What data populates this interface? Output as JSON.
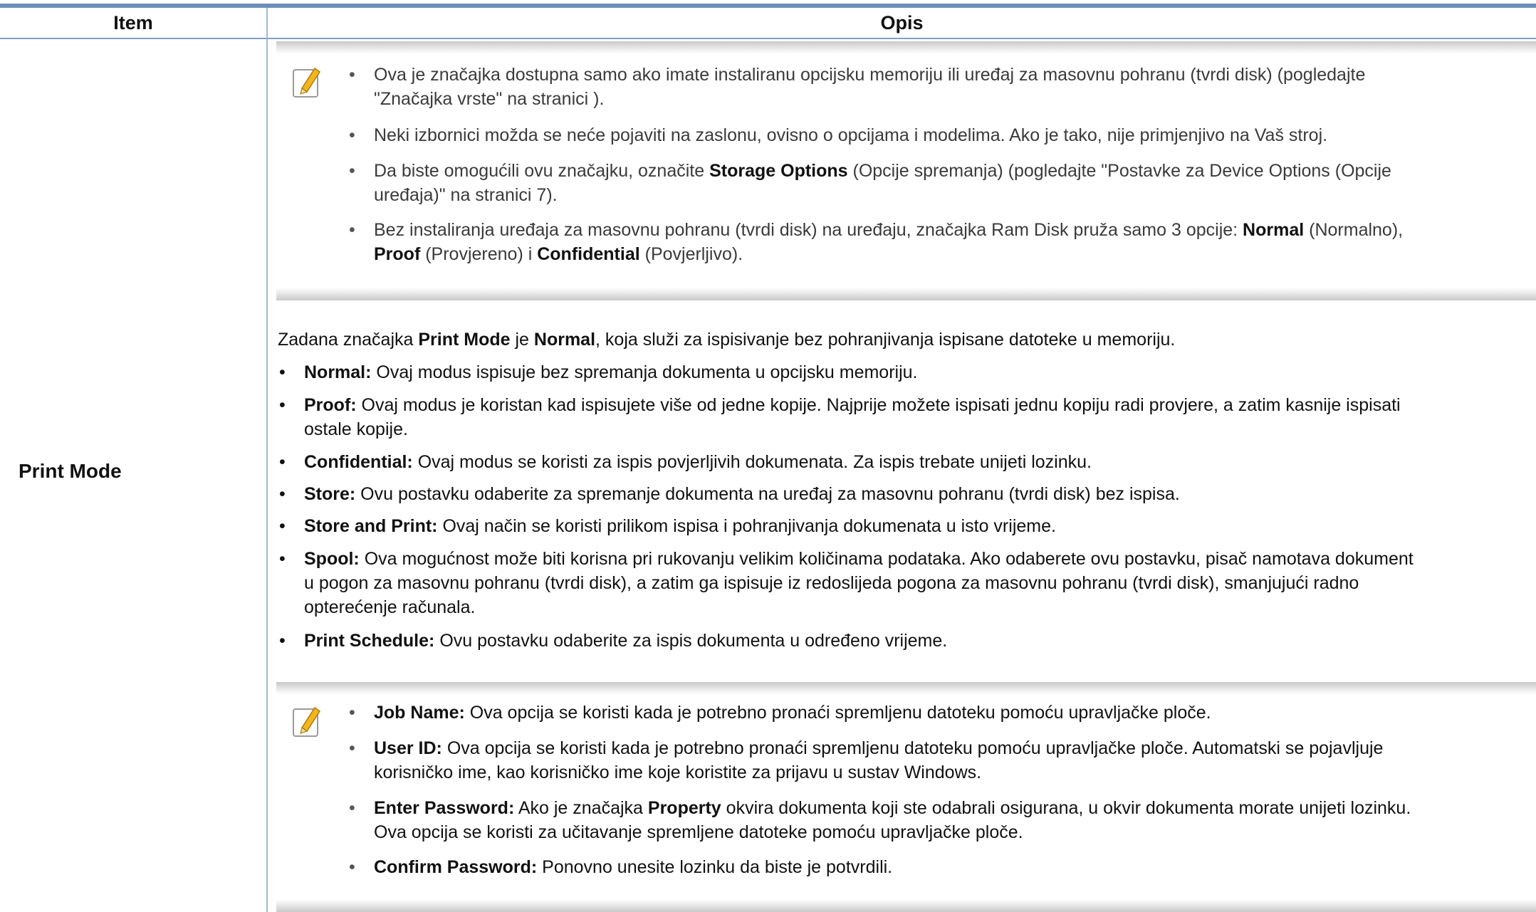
{
  "table": {
    "headers": {
      "item": "Item",
      "opis": "Opis"
    },
    "row_label": "Print Mode"
  },
  "note1": {
    "items": [
      {
        "line1": "Ova je značajka dostupna samo ako imate instaliranu opcijsku memoriju ili uređaj za masovnu pohranu (tvrdi disk) (pogledajte",
        "line2": "\"Značajka vrste\" na stranici )."
      },
      {
        "line1": "Neki izbornici možda se neće pojaviti na zaslonu, ovisno o opcijama i modelima. Ako je tako, nije primjenjivo na Vaš stroj."
      },
      {
        "pre": "Da biste omogućili ovu značajku, označite ",
        "bold": "Storage Options",
        "post": " (Opcije spremanja) (pogledajte \"Postavke za Device Options (Opcije",
        "line2": "uređaja)\" na stranici 7)."
      },
      {
        "pre": "Bez instaliranja uređaja za masovnu pohranu (tvrdi disk) na uređaju, značajka Ram Disk pruža samo 3 opcije: ",
        "b1": "Normal",
        "mid1": " (Normalno),",
        "b2": "Proof",
        "mid2": " (Provjereno) i ",
        "b3": "Confidential",
        "post": " (Povjerljivo)."
      }
    ]
  },
  "intro": {
    "pre": "Zadana značajka ",
    "b1": "Print Mode",
    "mid": " je ",
    "b2": "Normal",
    "post": ", koja služi za ispisivanje bez pohranjivanja ispisane datoteke u memoriju."
  },
  "modes": [
    {
      "term": "Normal:",
      "line1": " Ovaj modus ispisuje bez spremanja dokumenta u opcijsku memoriju."
    },
    {
      "term": "Proof:",
      "line1": " Ovaj modus je koristan kad ispisujete više od jedne kopije. Najprije možete ispisati jednu kopiju radi provjere, a zatim kasnije ispisati",
      "line2": "ostale kopije."
    },
    {
      "term": "Confidential:",
      "line1": " Ovaj modus se koristi za ispis povjerljivih dokumenata. Za ispis trebate unijeti lozinku."
    },
    {
      "term": "Store:",
      "line1": " Ovu postavku odaberite za spremanje dokumenta na uređaj za masovnu pohranu (tvrdi disk) bez ispisa."
    },
    {
      "term": "Store and Print:",
      "line1": " Ovaj način se koristi prilikom ispisa i pohranjivanja dokumenata u isto vrijeme."
    },
    {
      "term": "Spool:",
      "line1": " Ova mogućnost može biti korisna pri rukovanju velikim količinama podataka. Ako odaberete ovu postavku, pisač namotava dokument",
      "line2": "u pogon za masovnu pohranu (tvrdi disk), a zatim ga ispisuje iz redoslijeda pogona za masovnu pohranu (tvrdi disk), smanjujući radno",
      "line3": "opterećenje računala."
    },
    {
      "term": "Print Schedule:",
      "line1": " Ovu postavku odaberite za ispis dokumenta u određeno vrijeme."
    }
  ],
  "note2": {
    "items": [
      {
        "term": "Job Name:",
        "line1": " Ova opcija se koristi kada je potrebno pronaći spremljenu datoteku pomoću upravljačke ploče."
      },
      {
        "term": "User ID:",
        "line1": " Ova opcija se koristi kada je potrebno pronaći spremljenu datoteku pomoću upravljačke ploče. Automatski se pojavljuje",
        "line2": "korisničko ime, kao korisničko ime koje koristite za prijavu u sustav Windows."
      },
      {
        "term": "Enter Password:",
        "pre": " Ako je značajka ",
        "bold": "Property",
        "post": " okvira dokumenta koji ste odabrali osigurana, u okvir dokumenta morate unijeti lozinku.",
        "line2": "Ova opcija se koristi za učitavanje spremljene datoteke pomoću upravljačke ploče."
      },
      {
        "term": "Confirm Password:",
        "line1": " Ponovno unesite lozinku da biste je potvrdili."
      }
    ]
  },
  "icons": {
    "note_icon": "pencil-note-icon"
  },
  "colors": {
    "header_rule": "#6a8fb8",
    "note_shade": "#c9c9c9",
    "pencil_yellow": "#f2b51b"
  }
}
